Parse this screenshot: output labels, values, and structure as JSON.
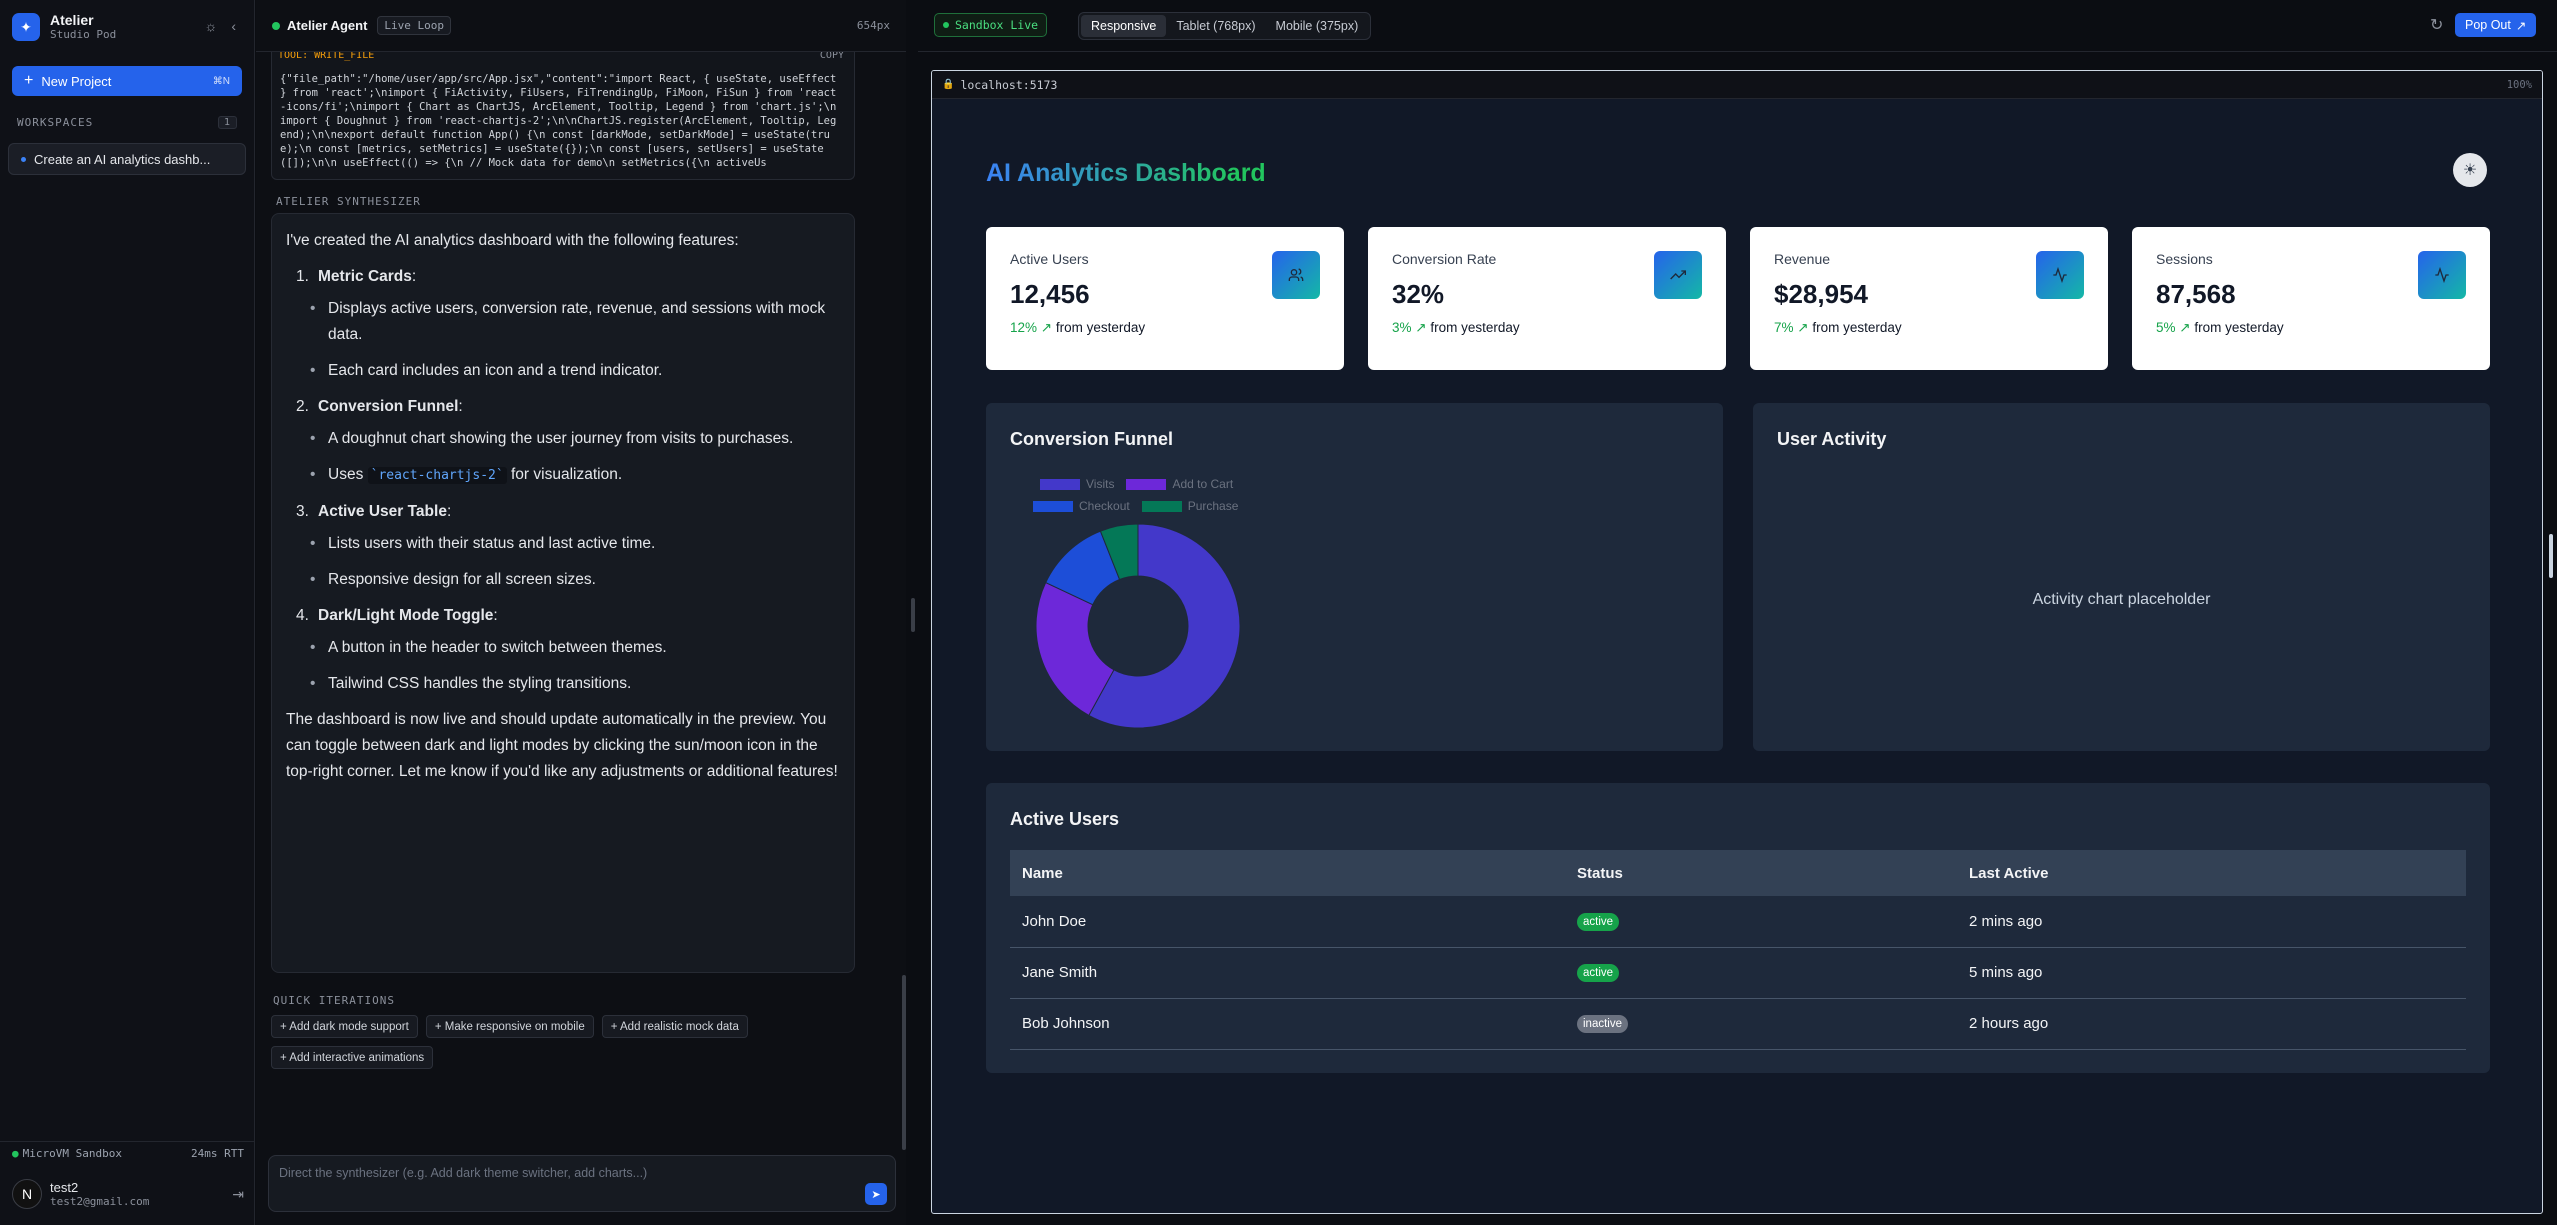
{
  "sidebar": {
    "brand_name": "Atelier",
    "brand_sub": "Studio Pod",
    "new_project_label": "New Project",
    "new_project_shortcut": "⌘N",
    "workspaces_label": "WORKSPACES",
    "workspaces_count": "1",
    "workspace_item": "Create an AI analytics dashb...",
    "sandbox_label": "MicroVM Sandbox",
    "sandbox_rtt": "24ms RTT",
    "user_initial": "N",
    "user_name": "test2",
    "user_email": "test2@gmail.com"
  },
  "chat": {
    "agent_name": "Atelier Agent",
    "mode_badge": "Live Loop",
    "width_readout": "654px",
    "tool_label": "TOOL: WRITE_FILE",
    "tool_copy": "COPY",
    "tool_code": "{\"file_path\":\"/home/user/app/src/App.jsx\",\"content\":\"import React, { useState, useEffect } from 'react';\\nimport { FiActivity, FiUsers, FiTrendingUp, FiMoon, FiSun } from 'react-icons/fi';\\nimport { Chart as ChartJS, ArcElement, Tooltip, Legend } from 'chart.js';\\nimport { Doughnut } from 'react-chartjs-2';\\n\\nChartJS.register(ArcElement, Tooltip, Legend);\\n\\nexport default function App() {\\n  const [darkMode, setDarkMode] = useState(true);\\n  const [metrics, setMetrics] = useState({});\\n  const [users, setUsers] = useState([]);\\n\\n  useEffect(() => {\\n    // Mock data for demo\\n    setMetrics({\\n      activeUs",
    "synth_label": "ATELIER SYNTHESIZER",
    "message": {
      "intro": "I've created the AI analytics dashboard with the following features:",
      "items": [
        {
          "num": "1.",
          "title": "Metric Cards",
          "bullets": [
            "Displays active users, conversion rate, revenue, and sessions with mock data.",
            "Each card includes an icon and a trend indicator."
          ]
        },
        {
          "num": "2.",
          "title": "Conversion Funnel",
          "bullets_pre": "A doughnut chart showing the user journey from visits to purchases.",
          "uses_pre": "Uses ",
          "uses_code": "`react-chartjs-2`",
          "uses_post": " for visualization."
        },
        {
          "num": "3.",
          "title": "Active User Table",
          "bullets": [
            "Lists users with their status and last active time.",
            "Responsive design for all screen sizes."
          ]
        },
        {
          "num": "4.",
          "title": "Dark/Light Mode Toggle",
          "bullets": [
            "A button in the header to switch between themes.",
            "Tailwind CSS handles the styling transitions."
          ]
        }
      ],
      "outro": "The dashboard is now live and should update automatically in the preview. You can toggle between dark and light modes by clicking the sun/moon icon in the top-right corner. Let me know if you'd like any adjustments or additional features!"
    },
    "quick_label": "QUICK ITERATIONS",
    "chips": [
      "+ Add dark mode support",
      "+ Make responsive on mobile",
      "+ Add realistic mock data",
      "+ Add interactive animations"
    ],
    "composer_placeholder": "Direct the synthesizer (e.g. Add dark theme switcher, add charts...)"
  },
  "preview": {
    "sandbox_status": "Sandbox Live",
    "viewports": [
      "Responsive",
      "Tablet (768px)",
      "Mobile (375px)"
    ],
    "active_viewport": "Responsive",
    "pop_out_label": "Pop Out",
    "url": "localhost:5173",
    "zoom": "100%"
  },
  "dashboard": {
    "title": "AI Analytics Dashboard",
    "cards": [
      {
        "label": "Active Users",
        "value": "12,456",
        "trend": "12%",
        "trend_suffix": "from yesterday",
        "icon": "users-icon"
      },
      {
        "label": "Conversion Rate",
        "value": "32%",
        "trend": "3%",
        "trend_suffix": "from yesterday",
        "icon": "trending-up-icon"
      },
      {
        "label": "Revenue",
        "value": "$28,954",
        "trend": "7%",
        "trend_suffix": "from yesterday",
        "icon": "activity-icon"
      },
      {
        "label": "Sessions",
        "value": "87,568",
        "trend": "5%",
        "trend_suffix": "from yesterday",
        "icon": "activity-icon"
      }
    ],
    "funnel_title": "Conversion Funnel",
    "activity_title": "User Activity",
    "activity_placeholder": "Activity chart placeholder",
    "users_title": "Active Users",
    "table_headers": [
      "Name",
      "Status",
      "Last Active"
    ],
    "users": [
      {
        "name": "John Doe",
        "status": "active",
        "last": "2 mins ago"
      },
      {
        "name": "Jane Smith",
        "status": "active",
        "last": "5 mins ago"
      },
      {
        "name": "Bob Johnson",
        "status": "inactive",
        "last": "2 hours ago"
      }
    ],
    "colors": {
      "accent": "#2563eb",
      "visits": "#4338ca",
      "add_to_cart": "#6d28d9",
      "checkout": "#1d4ed8",
      "purchase": "#047857"
    }
  },
  "chart_data": {
    "type": "pie",
    "categories": [
      "Visits",
      "Add to Cart",
      "Checkout",
      "Purchase"
    ],
    "values": [
      58,
      24,
      12,
      6
    ],
    "colors": [
      "#4338ca",
      "#6d28d9",
      "#1d4ed8",
      "#047857"
    ],
    "legend": "top"
  }
}
